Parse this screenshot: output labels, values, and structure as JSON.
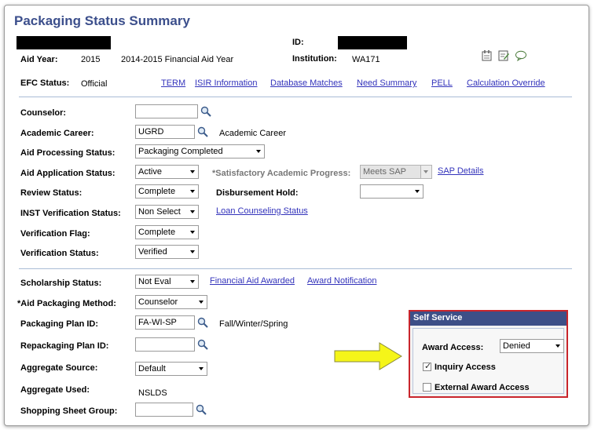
{
  "page": {
    "title": "Packaging Status Summary"
  },
  "header": {
    "id_label": "ID:",
    "aid_year_label": "Aid Year:",
    "aid_year_value": "2015",
    "aid_year_desc": "2014-2015 Financial Aid Year",
    "institution_label": "Institution:",
    "institution_value": "WA171",
    "efc_status_label": "EFC Status:",
    "efc_status_value": "Official"
  },
  "links_row": [
    "TERM",
    "ISIR Information",
    "Database Matches",
    "Need Summary",
    "PELL",
    "Calculation Override"
  ],
  "section1": {
    "counselor_label": "Counselor:",
    "counselor_value": "",
    "academic_career_label": "Academic Career:",
    "academic_career_value": "UGRD",
    "academic_career_desc": "Academic Career",
    "aid_processing_status_label": "Aid Processing Status:",
    "aid_processing_status_value": "Packaging Completed",
    "aid_application_status_label": "Aid Application Status:",
    "aid_application_status_value": "Active",
    "sap_label": "*Satisfactory Academic Progress:",
    "sap_value": "Meets SAP",
    "sap_details_link": "SAP Details",
    "review_status_label": "Review Status:",
    "review_status_value": "Complete",
    "disbursement_hold_label": "Disbursement Hold:",
    "disbursement_hold_value": "",
    "inst_verification_label": "INST Verification Status:",
    "inst_verification_value": "Non Select",
    "loan_counseling_link": "Loan Counseling Status",
    "verification_flag_label": "Verification Flag:",
    "verification_flag_value": "Complete",
    "verification_status_label": "Verification Status:",
    "verification_status_value": "Verified"
  },
  "section2": {
    "scholarship_status_label": "Scholarship Status:",
    "scholarship_status_value": "Not Eval",
    "financial_aid_awarded_link": "Financial Aid Awarded",
    "award_notification_link": "Award Notification",
    "aid_packaging_method_label": "*Aid Packaging Method:",
    "aid_packaging_method_value": "Counselor",
    "packaging_plan_id_label": "Packaging Plan ID:",
    "packaging_plan_id_value": "FA-WI-SP",
    "packaging_plan_desc": "Fall/Winter/Spring",
    "repackaging_plan_id_label": "Repackaging Plan ID:",
    "repackaging_plan_id_value": "",
    "aggregate_source_label": "Aggregate Source:",
    "aggregate_source_value": "Default",
    "aggregate_used_label": "Aggregate Used:",
    "aggregate_used_value": "NSLDS",
    "shopping_sheet_group_label": "Shopping Sheet Group:",
    "shopping_sheet_group_value": ""
  },
  "self_service": {
    "title": "Self Service",
    "award_access_label": "Award Access:",
    "award_access_value": "Denied",
    "inquiry_access_label": "Inquiry Access",
    "inquiry_access_checked": true,
    "external_award_access_label": "External Award Access",
    "external_award_access_checked": false
  },
  "colors": {
    "title": "#3c4f8c",
    "link": "#3333bb",
    "self_service_border": "#c9252c",
    "self_service_header": "#3d4f87",
    "arrow_fill": "#f5f519"
  },
  "icons": [
    "magnifier-icon",
    "notepad-icon",
    "edit-icon",
    "comment-icon",
    "arrow-icon"
  ]
}
